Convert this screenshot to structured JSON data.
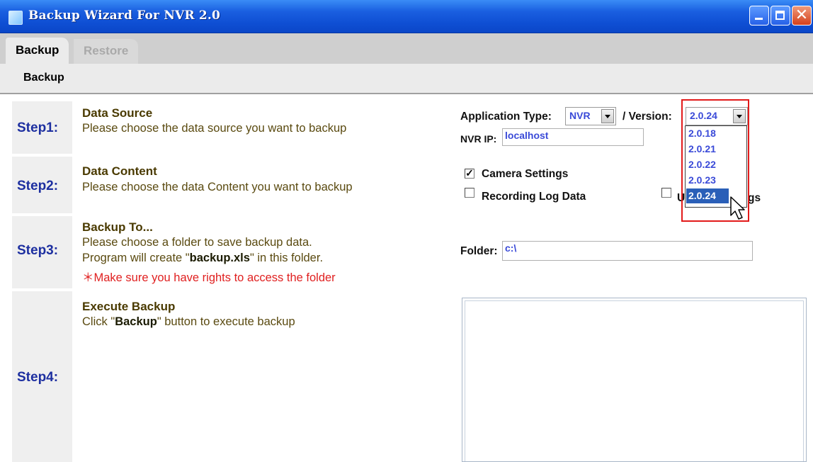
{
  "window": {
    "title": "Backup Wizard For NVR 2.0"
  },
  "tabs": [
    {
      "label": "Backup",
      "active": true
    },
    {
      "label": "Restore",
      "active": false
    }
  ],
  "subheader": {
    "label": "Backup"
  },
  "steps": [
    {
      "label": "Step1:",
      "title": "Data Source",
      "lines": [
        "Please choose the data source you want to backup"
      ]
    },
    {
      "label": "Step2:",
      "title": "Data Content",
      "lines": [
        "Please choose the data Content you want to backup"
      ]
    },
    {
      "label": "Step3:",
      "title": "Backup To...",
      "line1": "Please choose a folder to save backup data.",
      "line2_prefix": "Program will create \"",
      "line2_bold": "backup.xls",
      "line2_suffix": "\" in this folder.",
      "warning": "＊Make sure you have rights to access the folder"
    },
    {
      "label": "Step4:",
      "title": "Execute Backup",
      "line_prefix": "Click \"",
      "line_bold": "Backup",
      "line_suffix": "\" button to execute backup"
    }
  ],
  "source": {
    "app_type_label": "Application Type:",
    "app_type_value": "NVR",
    "version_label": "/ Version:",
    "version_value": "2.0.24",
    "version_options": [
      "2.0.18",
      "2.0.21",
      "2.0.22",
      "2.0.23",
      "2.0.24"
    ],
    "version_selected_index": 4,
    "nvr_ip_label": "NVR IP:",
    "nvr_ip_value": "localhost"
  },
  "content": {
    "camera_settings": {
      "label": "Camera Settings",
      "checked": true
    },
    "recording_log": {
      "label": "Recording Log Data",
      "checked": false
    },
    "third_checkbox_visible_tail": "s",
    "third_checkbox_visible_head": "U",
    "third_checkbox_visible_mid": "g"
  },
  "folder": {
    "label": "Folder:",
    "value": "c:\\"
  },
  "colors": {
    "titlebar": "#1a5fe0",
    "step_label": "#1d2fa0",
    "warning": "#e02020",
    "highlight": "#e21a1a",
    "selected_option": "#2a5fb8"
  }
}
